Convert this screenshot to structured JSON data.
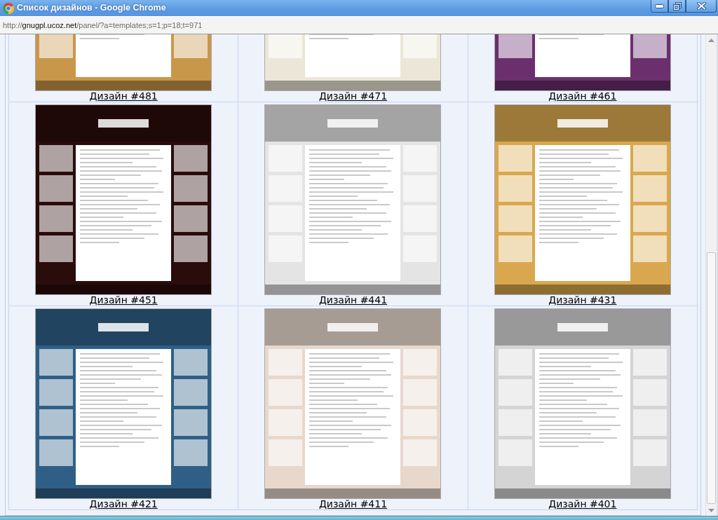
{
  "window": {
    "title": "Список дизайнов - Google Chrome"
  },
  "address_bar": {
    "scheme": "http://",
    "host": "gnugpl.ucoz.net",
    "path": "/panel/?a=templates;s=1;p=18;t=971"
  },
  "designs": [
    {
      "caption": "Дизайн #481",
      "color": "#c9974a"
    },
    {
      "caption": "Дизайн #471",
      "color": "#ece6d8"
    },
    {
      "caption": "Дизайн #461",
      "color": "#6b2f6e"
    },
    {
      "caption": "Дизайн #451",
      "color": "#2a0c0c"
    },
    {
      "caption": "Дизайн #441",
      "color": "#e4e4e4"
    },
    {
      "caption": "Дизайн #431",
      "color": "#d9a84e"
    },
    {
      "caption": "Дизайн #421",
      "color": "#2f5f86"
    },
    {
      "caption": "Дизайн #411",
      "color": "#e8d8cc"
    },
    {
      "caption": "Дизайн #401",
      "color": "#d4d4d4"
    }
  ]
}
